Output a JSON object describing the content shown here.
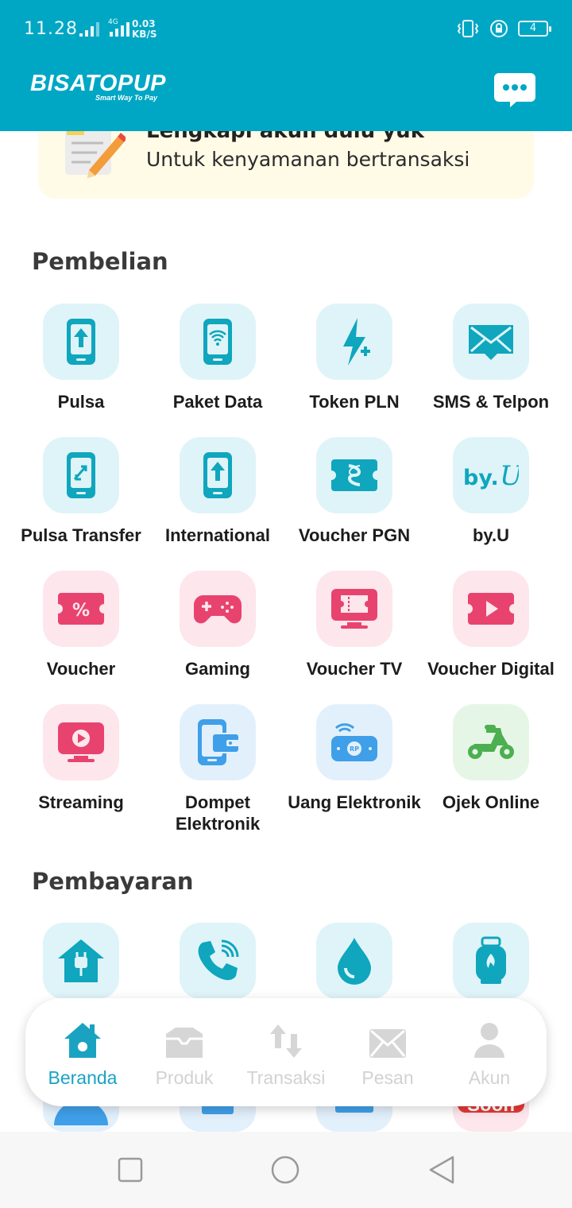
{
  "status_bar": {
    "time": "11.28",
    "net_speed_value": "0.03",
    "net_speed_unit": "KB/S",
    "network_type": "4G",
    "battery": "4"
  },
  "header": {
    "logo": "BISATOPUP",
    "tagline": "Smart Way To Pay"
  },
  "banner": {
    "title": "Lengkapi akun dulu yuk",
    "subtitle": "Untuk kenyamanan bertransaksi"
  },
  "sections": {
    "purchase_title": "Pembelian",
    "payment_title": "Pembayaran"
  },
  "purchase_items": [
    {
      "label": "Pulsa",
      "icon": "phone-upload-icon"
    },
    {
      "label": "Paket Data",
      "icon": "phone-wifi-icon"
    },
    {
      "label": "Token PLN",
      "icon": "lightning-plus-icon"
    },
    {
      "label": "SMS & Telpon",
      "icon": "envelope-icon"
    },
    {
      "label": "Pulsa Transfer",
      "icon": "phone-transfer-icon"
    },
    {
      "label": "International",
      "icon": "phone-upload-icon"
    },
    {
      "label": "Voucher PGN",
      "icon": "pgn-ticket-icon"
    },
    {
      "label": "by.U",
      "icon": "byu-logo-icon"
    },
    {
      "label": "Voucher",
      "icon": "percent-ticket-icon"
    },
    {
      "label": "Gaming",
      "icon": "gamepad-icon"
    },
    {
      "label": "Voucher TV",
      "icon": "tv-ticket-icon"
    },
    {
      "label": "Voucher Digital",
      "icon": "play-ticket-icon"
    },
    {
      "label": "Streaming",
      "icon": "tv-play-icon"
    },
    {
      "label": "Dompet Elektronik",
      "icon": "phone-wallet-icon"
    },
    {
      "label": "Uang Elektronik",
      "icon": "rp-card-icon"
    },
    {
      "label": "Ojek Online",
      "icon": "scooter-icon"
    }
  ],
  "payment_items": [
    {
      "icon": "house-plug-icon"
    },
    {
      "icon": "phone-call-icon"
    },
    {
      "icon": "water-drop-icon"
    },
    {
      "icon": "gas-cylinder-icon"
    }
  ],
  "payment_partial_badge": "Soon",
  "bottom_nav": [
    {
      "label": "Beranda",
      "icon": "home-icon",
      "active": true
    },
    {
      "label": "Produk",
      "icon": "box-icon",
      "active": false
    },
    {
      "label": "Transaksi",
      "icon": "transfer-arrows-icon",
      "active": false
    },
    {
      "label": "Pesan",
      "icon": "mail-icon",
      "active": false
    },
    {
      "label": "Akun",
      "icon": "person-icon",
      "active": false
    }
  ],
  "colors": {
    "brand": "#00a7c4",
    "teal_icon": "#0fa6be",
    "pink_icon": "#e8436f",
    "blue_icon": "#3f9fe8",
    "green_icon": "#4caf50",
    "banner_bg": "#fffbe6"
  }
}
